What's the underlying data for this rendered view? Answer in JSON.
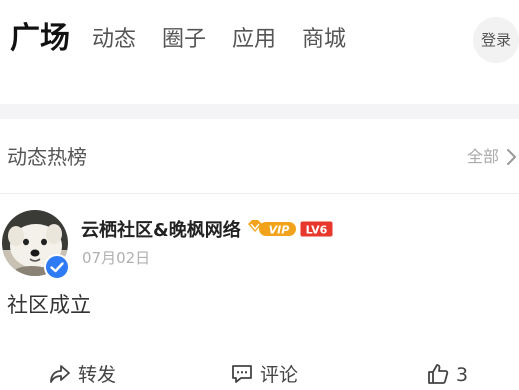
{
  "nav": {
    "tabs": [
      {
        "label": "广场",
        "active": true
      },
      {
        "label": "动态",
        "active": false
      },
      {
        "label": "圈子",
        "active": false
      },
      {
        "label": "应用",
        "active": false
      },
      {
        "label": "商城",
        "active": false
      }
    ],
    "login_label": "登录"
  },
  "hot_section": {
    "title": "动态热榜",
    "more_label": "全部"
  },
  "post": {
    "author": "云栖社区&晚枫网络",
    "vip_badge": "VIP",
    "level_badge": "LV6",
    "date": "07月02日",
    "content": "社区成立",
    "actions": {
      "share_label": "转发",
      "comment_label": "评论",
      "like_count": "3"
    }
  },
  "colors": {
    "accent_blue": "#2f7bf6",
    "vip_gold": "#f2a31b",
    "level_red": "#e8372c"
  },
  "icons": [
    "chevron-right-icon",
    "verified-icon",
    "share-icon",
    "comment-icon",
    "like-icon"
  ]
}
